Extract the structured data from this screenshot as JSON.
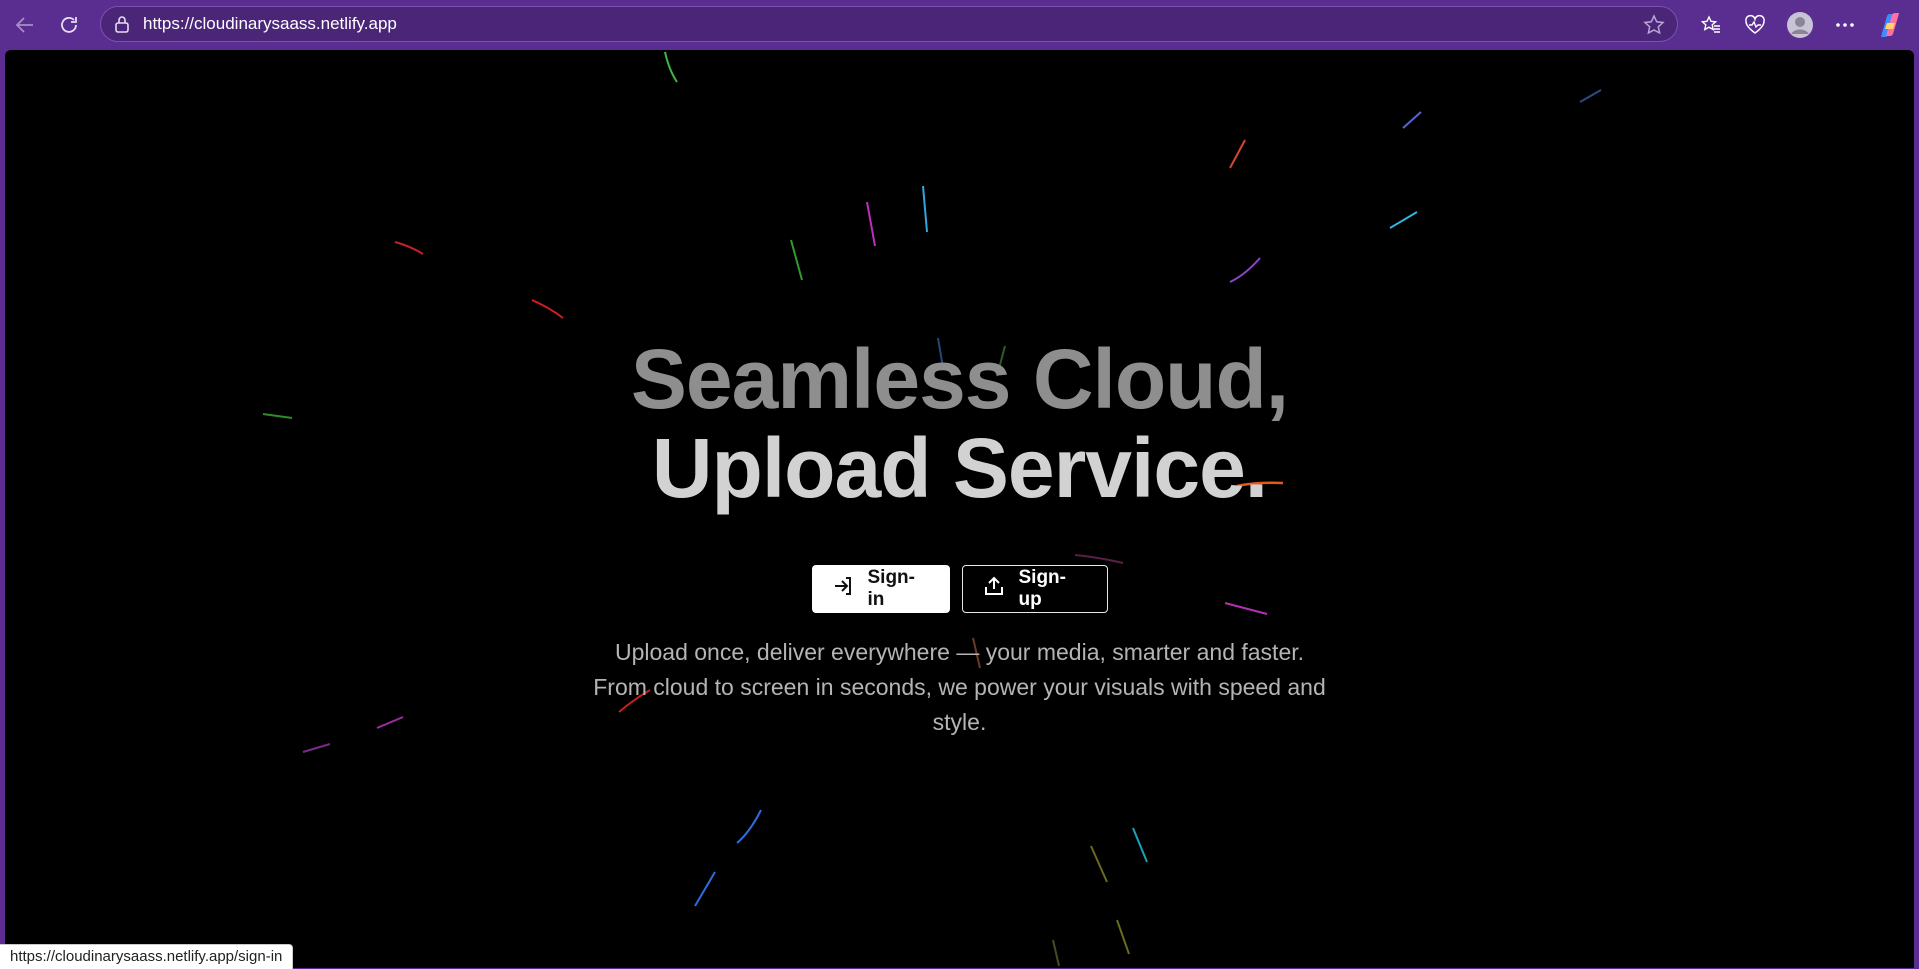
{
  "browser": {
    "url": "https://cloudinarysaass.netlify.app",
    "status_url": "https://cloudinarysaass.netlify.app/sign-in",
    "icons": [
      "back-icon",
      "refresh-icon",
      "lock-icon",
      "favorite-star-icon",
      "favorites-icon",
      "health-icon",
      "profile-icon",
      "more-icon",
      "copilot-icon"
    ]
  },
  "hero": {
    "title_line1": "Seamless Cloud,",
    "title_line2": "Upload Service.",
    "signin_label": "Sign-in",
    "signup_label": "Sign-up",
    "sub_line1": "Upload once, deliver everywhere — your media, smarter and faster.",
    "sub_line2": "From cloud to screen in seconds, we power your visuals with speed and",
    "sub_line3": "style."
  },
  "colors": {
    "chrome": "#5a2d90",
    "page_bg": "#000000",
    "title_gray": "#8e8e8e",
    "title_light": "#d2d2d2"
  }
}
